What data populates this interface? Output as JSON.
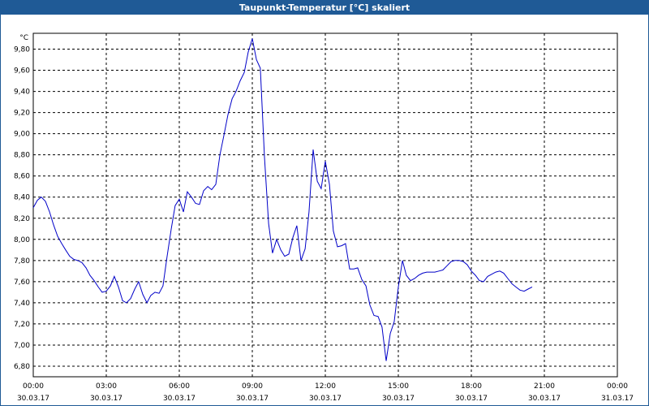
{
  "window": {
    "title": "Taupunkt-Temperatur [°C] skaliert"
  },
  "chart_data": {
    "type": "line",
    "title": "Taupunkt-Temperatur [°C] skaliert",
    "ylabel": "°C",
    "xlabel": "",
    "ylim": [
      6.7,
      9.95
    ],
    "y_ticks": [
      "9,80",
      "9,60",
      "9,40",
      "9,20",
      "9,00",
      "8,80",
      "8,60",
      "8,40",
      "8,20",
      "8,00",
      "7,80",
      "7,60",
      "7,40",
      "7,20",
      "7,00",
      "6,80"
    ],
    "y_tick_values": [
      9.8,
      9.6,
      9.4,
      9.2,
      9.0,
      8.8,
      8.6,
      8.4,
      8.2,
      8.0,
      7.8,
      7.6,
      7.4,
      7.2,
      7.0,
      6.8
    ],
    "x_range_hours": [
      0,
      24
    ],
    "x_ticks": [
      {
        "time": "00:00",
        "date": "30.03.17"
      },
      {
        "time": "03:00",
        "date": "30.03.17"
      },
      {
        "time": "06:00",
        "date": "30.03.17"
      },
      {
        "time": "09:00",
        "date": "30.03.17"
      },
      {
        "time": "12:00",
        "date": "30.03.17"
      },
      {
        "time": "15:00",
        "date": "30.03.17"
      },
      {
        "time": "18:00",
        "date": "30.03.17"
      },
      {
        "time": "21:00",
        "date": "30.03.17"
      },
      {
        "time": "00:00",
        "date": "31.03.17"
      }
    ],
    "grid": true,
    "series": [
      {
        "color": "#0000c8",
        "x_hours": [
          0,
          0.17,
          0.33,
          0.5,
          0.67,
          0.83,
          1,
          1.17,
          1.33,
          1.5,
          1.67,
          1.83,
          2,
          2.17,
          2.33,
          2.5,
          2.67,
          2.83,
          3,
          3.17,
          3.33,
          3.5,
          3.67,
          3.83,
          4,
          4.17,
          4.33,
          4.5,
          4.67,
          4.83,
          5,
          5.17,
          5.33,
          5.5,
          5.67,
          5.83,
          6,
          6.17,
          6.33,
          6.5,
          6.67,
          6.83,
          7,
          7.17,
          7.33,
          7.5,
          7.67,
          7.83,
          8,
          8.17,
          8.33,
          8.5,
          8.67,
          8.83,
          9,
          9.17,
          9.33,
          9.5,
          9.67,
          9.83,
          10,
          10.17,
          10.33,
          10.5,
          10.67,
          10.83,
          11,
          11.17,
          11.33,
          11.5,
          11.67,
          11.83,
          12,
          12.17,
          12.33,
          12.5,
          12.67,
          12.83,
          13,
          13.17,
          13.33,
          13.5,
          13.67,
          13.83,
          14,
          14.17,
          14.33,
          14.5,
          14.67,
          14.83,
          15,
          15.17,
          15.33,
          15.5,
          15.67,
          15.83,
          16,
          16.17,
          16.33,
          16.5,
          16.67,
          16.83,
          17,
          17.17,
          17.33,
          17.5,
          17.67,
          17.83,
          18,
          18.17,
          18.33,
          18.5,
          18.67,
          18.83,
          19,
          19.17,
          19.33,
          19.5,
          19.67,
          19.83,
          20,
          20.17,
          20.33,
          20.5,
          20.67,
          20.83,
          21,
          21.17,
          21.33,
          21.5,
          21.67,
          21.83,
          22,
          22.17,
          22.33,
          22.5,
          22.67,
          22.83,
          23,
          23.17,
          23.33,
          23.5,
          23.67,
          23.83
        ],
        "values": [
          8.3,
          8.37,
          8.4,
          8.36,
          8.26,
          8.14,
          8.03,
          7.96,
          7.9,
          7.84,
          7.81,
          7.8,
          7.78,
          7.73,
          7.66,
          7.61,
          7.55,
          7.5,
          7.51,
          7.56,
          7.65,
          7.55,
          7.42,
          7.4,
          7.44,
          7.53,
          7.6,
          7.48,
          7.4,
          7.47,
          7.5,
          7.49,
          7.56,
          7.84,
          8.1,
          8.32,
          8.38,
          8.26,
          8.45,
          8.4,
          8.34,
          8.33,
          8.46,
          8.5,
          8.47,
          8.52,
          8.8,
          8.98,
          9.18,
          9.33,
          9.4,
          9.5,
          9.58,
          9.77,
          9.9,
          9.7,
          9.62,
          8.78,
          8.15,
          7.87,
          8.0,
          7.9,
          7.84,
          7.86,
          8.02,
          8.13,
          7.8,
          7.91,
          8.26,
          8.85,
          8.55,
          8.48,
          8.74,
          8.52,
          8.08,
          7.93,
          7.94,
          7.96,
          7.72,
          7.72,
          7.73,
          7.62,
          7.56,
          7.38,
          7.28,
          7.27,
          7.17,
          6.85,
          7.11,
          7.22,
          7.55,
          7.8,
          7.66,
          7.61,
          7.63,
          7.66,
          7.68,
          7.69,
          7.69,
          7.69,
          7.7,
          7.71,
          7.75,
          7.79,
          7.8,
          7.8,
          7.79,
          7.76,
          7.7,
          7.66,
          7.61,
          7.6,
          7.65,
          7.67,
          7.69,
          7.7,
          7.68,
          7.63,
          7.58,
          7.55,
          7.52,
          7.51,
          7.53,
          7.55
        ]
      }
    ]
  }
}
